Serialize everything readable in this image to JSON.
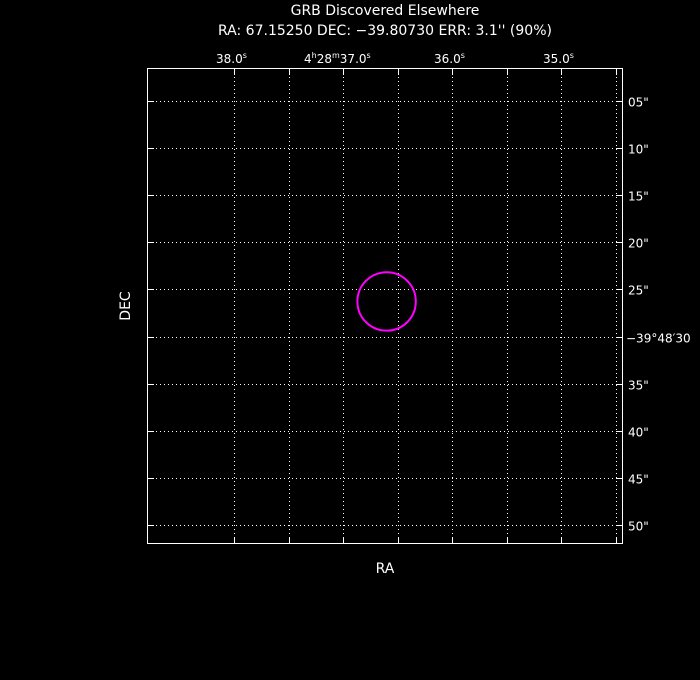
{
  "chart_data": {
    "type": "scatter",
    "title": "GRB Discovered Elsewhere",
    "subtitle": "RA: 67.15250   DEC: −39.80730   ERR: 3.1'' (90%)",
    "xlabel": "RA",
    "ylabel": "DEC",
    "grid": true,
    "x_ticks": [
      {
        "label": "38.0",
        "sup": "s"
      },
      {
        "h": "4",
        "m": "28",
        "s": "37.0",
        "sup": "s"
      },
      {
        "label": "36.0",
        "sup": "s"
      },
      {
        "label": "35.0",
        "sup": "s"
      }
    ],
    "y_ticks": [
      "05\"",
      "10\"",
      "15\"",
      "20\"",
      "25\"",
      "−39°48′30",
      "35\"",
      "40\"",
      "45\"",
      "50\""
    ],
    "ra_tick_seconds": [
      38.0,
      37.5,
      37.0,
      36.5,
      36.0,
      35.5,
      35.0,
      34.5
    ],
    "dec_tick_arcsec": [
      5,
      10,
      15,
      20,
      25,
      30,
      35,
      40,
      45,
      50
    ],
    "error_circle": {
      "ra_deg": 67.1525,
      "dec_deg": -39.8073,
      "ra_seconds": 36.6,
      "dec_arcsec": 26.28,
      "radius_arcsec": 3.1,
      "confidence": "90%",
      "color": "#ff00ff"
    },
    "colors": {
      "background": "#000000",
      "foreground": "#ffffff",
      "grid": "#ffffff"
    }
  }
}
